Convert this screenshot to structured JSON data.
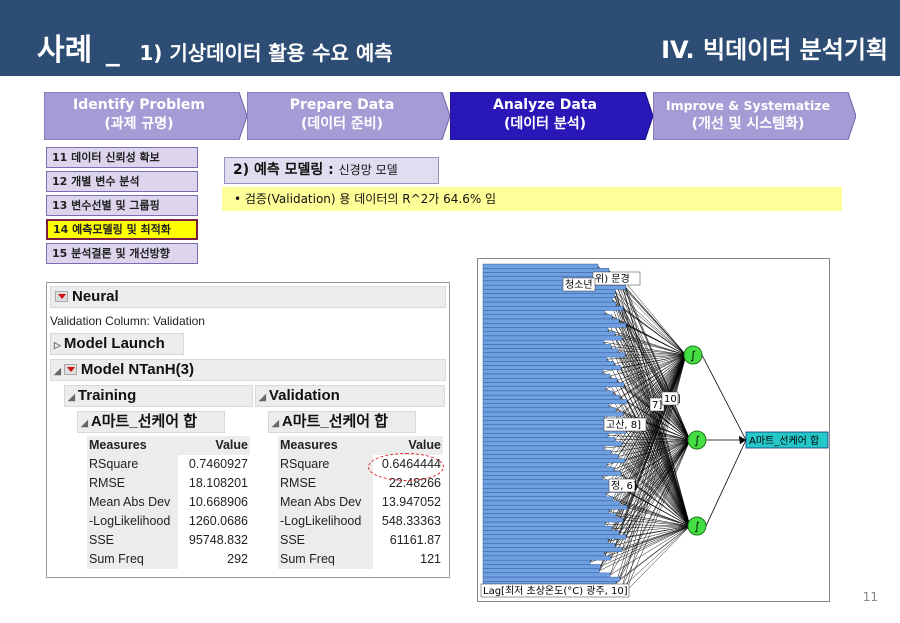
{
  "header": {
    "title_main": "사례",
    "title_sep": "_",
    "title_sub": "1) 기상데이터 활용 수요 예측",
    "section": "IV. 빅데이터 분석기획"
  },
  "steps": [
    {
      "label": "Identify Problem",
      "sub": "(과제 규명)",
      "color": "#a79bd6",
      "active": false
    },
    {
      "label": "Prepare Data",
      "sub": "(데이터 준비)",
      "color": "#a79bd6",
      "active": false
    },
    {
      "label": "Analyze Data",
      "sub": "(데이터 분석)",
      "color": "#2a17b8",
      "active": true
    },
    {
      "label": "Improve & Systematize",
      "sub": "(개선 및 시스템화)",
      "color": "#a79bd6",
      "active": false
    }
  ],
  "menu": [
    {
      "label": "11 데이터 신뢰성 확보",
      "active": false
    },
    {
      "label": "12 개별 변수 분석",
      "active": false
    },
    {
      "label": "13 변수선별 및 그룹핑",
      "active": false
    },
    {
      "label": "14 예측모델링 및 최적화",
      "active": true
    },
    {
      "label": "15 분석결론 및 개선방향",
      "active": false
    }
  ],
  "section": {
    "title": "2) 예측 모델링 :",
    "title_small": "신경망 모델",
    "bullet": "•   검증(Validation) 용 데이터의 R^2가 64.6% 임"
  },
  "jmp": {
    "neural": "Neural",
    "validation_column": "Validation Column: Validation",
    "model_launch": "Model Launch",
    "model": "Model NTanH(3)",
    "training": {
      "title": "Training",
      "target": "A마트_선케어 합",
      "col_measures": "Measures",
      "col_value": "Value",
      "rows": [
        {
          "m": "RSquare",
          "v": "0.7460927"
        },
        {
          "m": "RMSE",
          "v": "18.108201"
        },
        {
          "m": "Mean Abs Dev",
          "v": "10.668906"
        },
        {
          "m": "-LogLikelihood",
          "v": "1260.0686"
        },
        {
          "m": "SSE",
          "v": "95748.832"
        },
        {
          "m": "Sum Freq",
          "v": "292"
        }
      ]
    },
    "validation": {
      "title": "Validation",
      "target": "A마트_선케어 합",
      "col_measures": "Measures",
      "col_value": "Value",
      "rows": [
        {
          "m": "RSquare",
          "v": "0.6464444"
        },
        {
          "m": "RMSE",
          "v": "22.48266"
        },
        {
          "m": "Mean Abs Dev",
          "v": "13.947052"
        },
        {
          "m": "-LogLikelihood",
          "v": "548.33363"
        },
        {
          "m": "SSE",
          "v": "61161.87"
        },
        {
          "m": "Sum Freq",
          "v": "121"
        }
      ]
    }
  },
  "network": {
    "input_label_top": "위) 문경",
    "input_label_top2": "청소년",
    "input_label_mid1": "7]",
    "input_label_mid2": "10]",
    "input_label_mid3": "고산, 8]",
    "input_label_mid4": "정, 6]",
    "input_label_bottom": "Lag[최저 초상온도(°C) 광주, 10]",
    "output_label": "A마트_선케어 합",
    "hidden_symbol": "∫"
  },
  "page_number": "11"
}
